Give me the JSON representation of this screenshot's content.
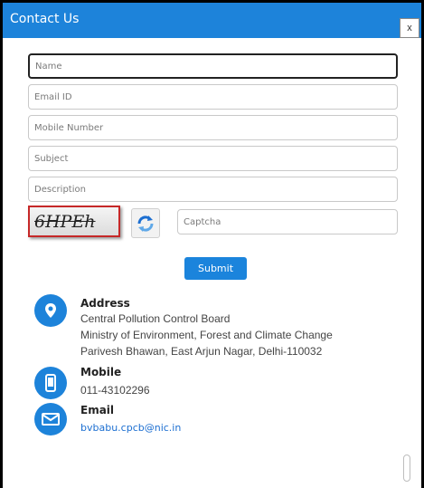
{
  "dialog": {
    "title": "Contact Us",
    "close_label": "x"
  },
  "form": {
    "name_placeholder": "Name",
    "email_placeholder": "Email ID",
    "mobile_placeholder": "Mobile Number",
    "subject_placeholder": "Subject",
    "description_placeholder": "Description",
    "captcha_image_text": "6HPEh",
    "captcha_placeholder": "Captcha",
    "submit_label": "Submit"
  },
  "contact": {
    "address": {
      "icon": "location-pin-icon",
      "title": "Address",
      "lines": [
        "Central Pollution Control Board",
        "Ministry of Environment, Forest and Climate Change",
        "Parivesh Bhawan, East Arjun Nagar, Delhi-110032"
      ]
    },
    "mobile": {
      "icon": "mobile-phone-icon",
      "title": "Mobile",
      "value": "011-43102296"
    },
    "email": {
      "icon": "envelope-icon",
      "title": "Email",
      "value": "bvbabu.cpcb@nic.in"
    }
  },
  "colors": {
    "accent": "#1d83da",
    "captcha_border": "#c62828"
  }
}
